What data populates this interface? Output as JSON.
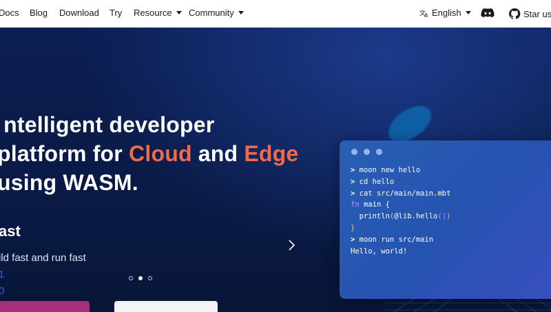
{
  "nav": {
    "items": [
      {
        "label": "Docs"
      },
      {
        "label": "Blog"
      },
      {
        "label": "Download"
      },
      {
        "label": "Try"
      },
      {
        "label": "Resource"
      },
      {
        "label": "Community"
      }
    ],
    "language": "English",
    "star_label": "Star us"
  },
  "hero": {
    "title_line1": "ntelligent developer",
    "title_line2_prefix": "platform for ",
    "title_cloud": "Cloud",
    "title_and": " and ",
    "title_edge": "Edge",
    "title_line3": "using WASM.",
    "sub_heading": "ast",
    "sub_text": "ild fast and run fast",
    "side_digit_1": "1",
    "side_digit_2": "0"
  },
  "carousel": {
    "dot_count": 3,
    "active_index": 1
  },
  "terminal": {
    "lines": [
      "moon new hello",
      "cd hello",
      "cat src/main/main.mbt"
    ],
    "code_fn_kw": "fn",
    "code_fn_name": " main {",
    "code_println": "  println",
    "code_arg": "@lib.hello",
    "code_close": "}",
    "run_line": "moon run src/main",
    "output": "Hello, world!",
    "prompt": ">"
  },
  "colors": {
    "accent": "#f26a4b",
    "hero_bg": "#0c1f54",
    "terminal_bg": "#2553b0",
    "primary_button": "#a5307a"
  }
}
